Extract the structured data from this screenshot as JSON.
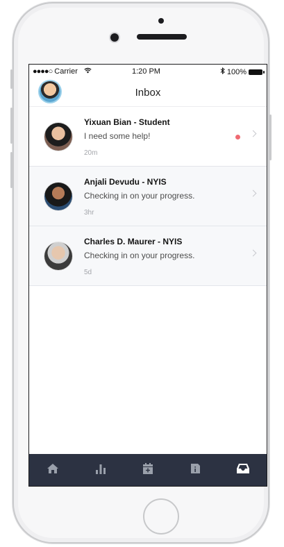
{
  "status_bar": {
    "carrier": "Carrier",
    "time": "1:20 PM",
    "battery": "100%"
  },
  "header": {
    "title": "Inbox"
  },
  "conversations": [
    {
      "name": "Yixuan Bian - Student",
      "message": "I need some help!",
      "time": "20m",
      "unread": true
    },
    {
      "name": "Anjali Devudu - NYIS",
      "message": "Checking in on your progress.",
      "time": "3hr",
      "unread": false
    },
    {
      "name": "Charles D. Maurer - NYIS",
      "message": "Checking in on your progress.",
      "time": "5d",
      "unread": false
    }
  ],
  "tab_bar": {
    "tabs": [
      {
        "icon": "home-icon",
        "active": false
      },
      {
        "icon": "bar-chart-icon",
        "active": false
      },
      {
        "icon": "calendar-add-icon",
        "active": false
      },
      {
        "icon": "info-icon",
        "active": false
      },
      {
        "icon": "inbox-icon",
        "active": true
      }
    ],
    "active_color": "#ffffff",
    "inactive_color": "#9aa0ab",
    "background": "#2c3242"
  },
  "colors": {
    "unread_dot": "#ef6a72"
  }
}
